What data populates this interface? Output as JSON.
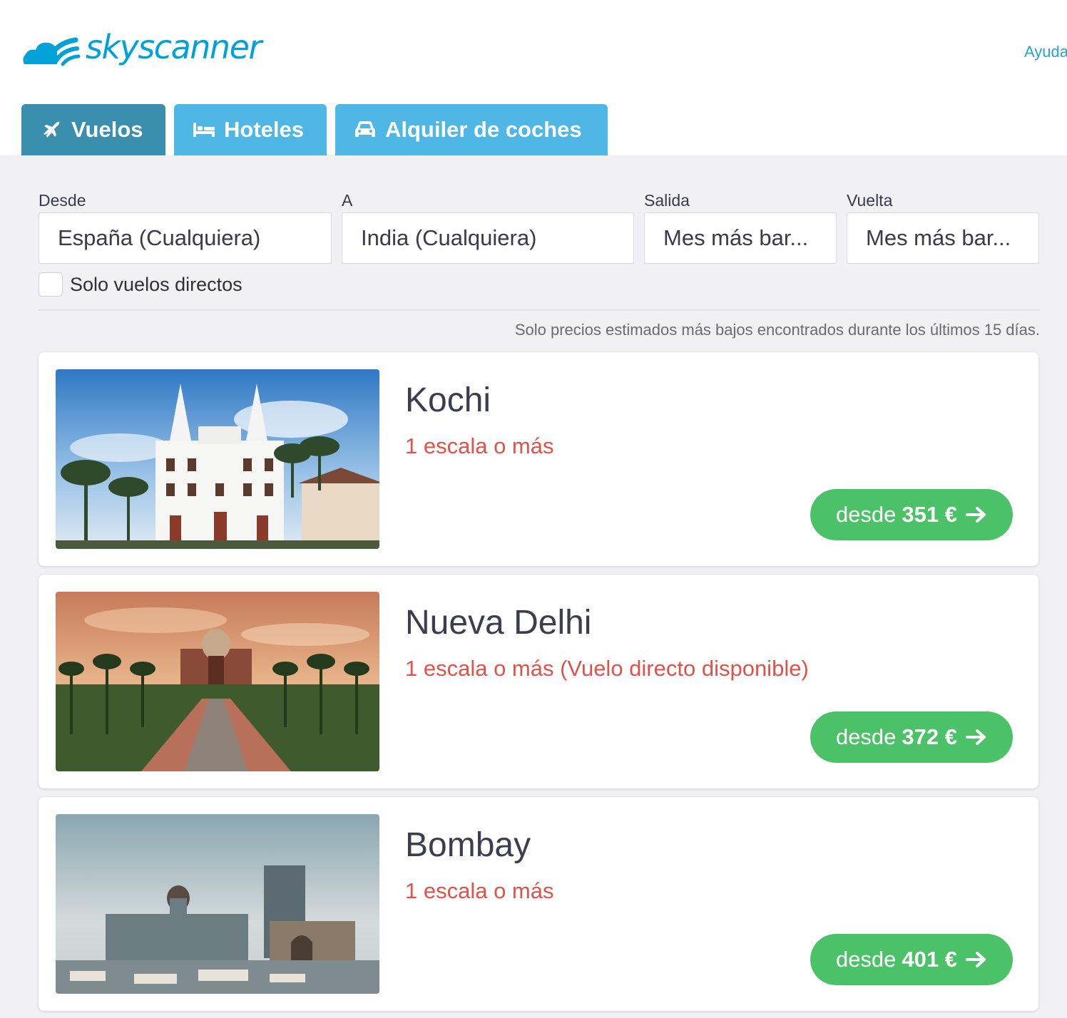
{
  "header": {
    "logo_text": "skyscanner",
    "help_label": "Ayuda"
  },
  "tabs": [
    {
      "label": "Vuelos",
      "icon": "plane-icon",
      "active": true
    },
    {
      "label": "Hoteles",
      "icon": "bed-icon",
      "active": false
    },
    {
      "label": "Alquiler de coches",
      "icon": "car-icon",
      "active": false
    }
  ],
  "search": {
    "from_label": "Desde",
    "from_value": "España (Cualquiera)",
    "to_label": "A",
    "to_value": "India (Cualquiera)",
    "depart_label": "Salida",
    "depart_value": "Mes más bar...",
    "return_label": "Vuelta",
    "return_value": "Mes más bar...",
    "direct_only_label": "Solo vuelos directos",
    "direct_only_checked": false
  },
  "disclaimer": "Solo precios estimados más bajos encontrados durante los últimos 15 días.",
  "results": [
    {
      "city": "Kochi",
      "stops": "1 escala o más",
      "price_prefix": "desde",
      "price": "351 €"
    },
    {
      "city": "Nueva Delhi",
      "stops": "1 escala o más (Vuelo directo disponible)",
      "price_prefix": "desde",
      "price": "372 €"
    },
    {
      "city": "Bombay",
      "stops": "1 escala o más",
      "price_prefix": "desde",
      "price": "401 €"
    }
  ],
  "colors": {
    "brand": "#00a2d9",
    "tab": "#4fb7e6",
    "tab_active": "#3a8fae",
    "price_button": "#4cc268",
    "stops_text": "#e0534a"
  }
}
